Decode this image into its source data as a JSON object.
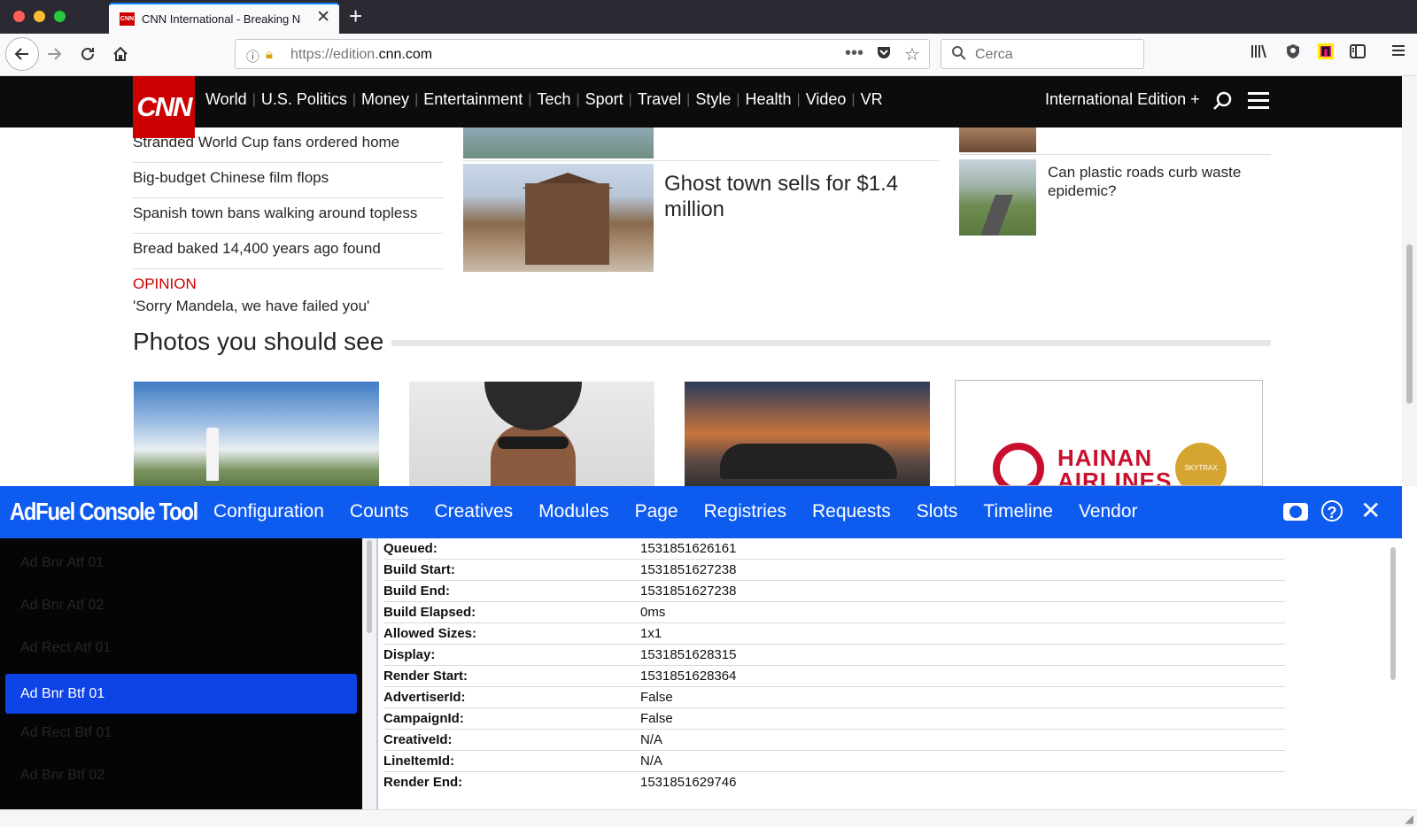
{
  "browser": {
    "tab_title": "CNN International - Breaking Ne",
    "favicon_text": "CNN",
    "url_prefix": "https://edition.",
    "url_domain": "cnn.com",
    "search_placeholder": "Cerca",
    "icons": [
      "back-arrow-icon",
      "forward-arrow-icon",
      "reload-icon",
      "home-icon",
      "info-icon",
      "lock-warning-icon",
      "more-dots-icon",
      "pocket-icon",
      "bookmark-star-icon",
      "search-icon",
      "library-icon",
      "privacy-badger-icon",
      "extension-icon",
      "sidebar-icon",
      "hamburger-menu-icon"
    ]
  },
  "cnn": {
    "logo": "CNN",
    "nav": [
      "World",
      "U.S. Politics",
      "Money",
      "Entertainment",
      "Tech",
      "Sport",
      "Travel",
      "Style",
      "Health",
      "Video",
      "VR"
    ],
    "edition": "International Edition +",
    "headlines": [
      {
        "text": "Stranded World Cup fans ordered home"
      },
      {
        "text": "Big-budget Chinese film flops"
      },
      {
        "text": "Spanish town bans walking around topless"
      },
      {
        "text": "Bread baked 14,400 years ago found"
      },
      {
        "label": "OPINION",
        "text": "'Sorry Mandela, we have failed you'"
      }
    ],
    "ghost_story": "Ghost town sells for $1.4 million",
    "road_story": "Can plastic roads curb waste epidemic?",
    "section_title": "Photos you should see",
    "ad": {
      "brand": "HAINAN AIRLINES",
      "badge": "SKYTRAX"
    }
  },
  "adfuel": {
    "title": "AdFuel Console Tool",
    "tabs": [
      "Configuration",
      "Counts",
      "Creatives",
      "Modules",
      "Page",
      "Registries",
      "Requests",
      "Slots",
      "Timeline",
      "Vendor"
    ],
    "slots": [
      {
        "label": "Ad Bnr Atf 01",
        "selected": false
      },
      {
        "label": "Ad Bnr Atf 02",
        "selected": false
      },
      {
        "label": "Ad Rect Atf 01",
        "selected": false
      },
      {
        "label": "Ad Bnr Btf 01",
        "selected": true
      },
      {
        "label": "Ad Rect Btf 01",
        "selected": false
      },
      {
        "label": "Ad Bnr Btf 02",
        "selected": false
      }
    ],
    "details": [
      {
        "key": "Queued:",
        "value": "1531851626161"
      },
      {
        "key": "Build Start:",
        "value": "1531851627238"
      },
      {
        "key": "Build End:",
        "value": "1531851627238"
      },
      {
        "key": "Build Elapsed:",
        "value": "0ms"
      },
      {
        "key": "Allowed Sizes:",
        "value": "1x1"
      },
      {
        "key": "Display:",
        "value": "1531851628315"
      },
      {
        "key": "Render Start:",
        "value": "1531851628364"
      },
      {
        "key": "AdvertiserId:",
        "value": "False"
      },
      {
        "key": "CampaignId:",
        "value": "False"
      },
      {
        "key": "CreativeId:",
        "value": "N/A"
      },
      {
        "key": "LineItemId:",
        "value": "N/A"
      },
      {
        "key": "Render End:",
        "value": "1531851629746"
      }
    ],
    "colors": {
      "bar": "#0e5bf0",
      "selected": "#0e44e6"
    }
  }
}
